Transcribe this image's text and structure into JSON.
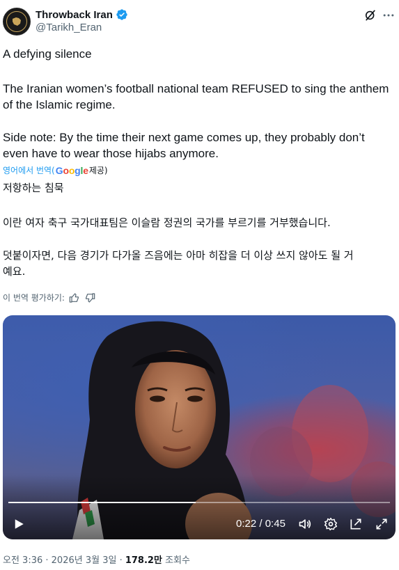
{
  "account": {
    "display_name": "Throwback Iran",
    "handle": "@Tarikh_Eran",
    "avatar_text": "THROWBACK IRAN",
    "verified": true
  },
  "post": {
    "original_lines": [
      "A defying silence",
      "The Iranian women’s football national team REFUSED to sing the anthem",
      "of the Islamic regime.",
      "Side note: By the time their next game comes up, they probably don’t",
      "even have to wear those hijabs anymore."
    ],
    "translation_note": {
      "prefix": "영어에서 번역(",
      "provider": "Google",
      "suffix": " 제공)"
    },
    "translated_lines": [
      "저항하는 침묵",
      "이란 여자 축구 국가대표팀은 이슬람 정권의 국가를 부르기를 거부했습니다.",
      "덧붙이자면, 다음 경기가 다가올 즈음에는 아마 히잡을 더 이상 쓰지 않아도 될 거",
      "예요."
    ],
    "rate_translation_label": "이 번역 평가하기:"
  },
  "video": {
    "current_time": "0:22",
    "duration": "0:45",
    "progress": 0.49
  },
  "footer": {
    "time": "오전 3:36",
    "date": "2026년 3월 3일",
    "views": "178.2만",
    "views_label": "조회수"
  },
  "colors": {
    "link": "#1d9bf0",
    "secondary_text": "#536471",
    "verified": "#1d9bf0"
  },
  "icons": [
    "grok-icon",
    "more-icon",
    "verified-icon",
    "thumbs-up-icon",
    "thumbs-down-icon",
    "play-icon",
    "volume-icon",
    "settings-icon",
    "pip-icon",
    "fullscreen-icon"
  ]
}
